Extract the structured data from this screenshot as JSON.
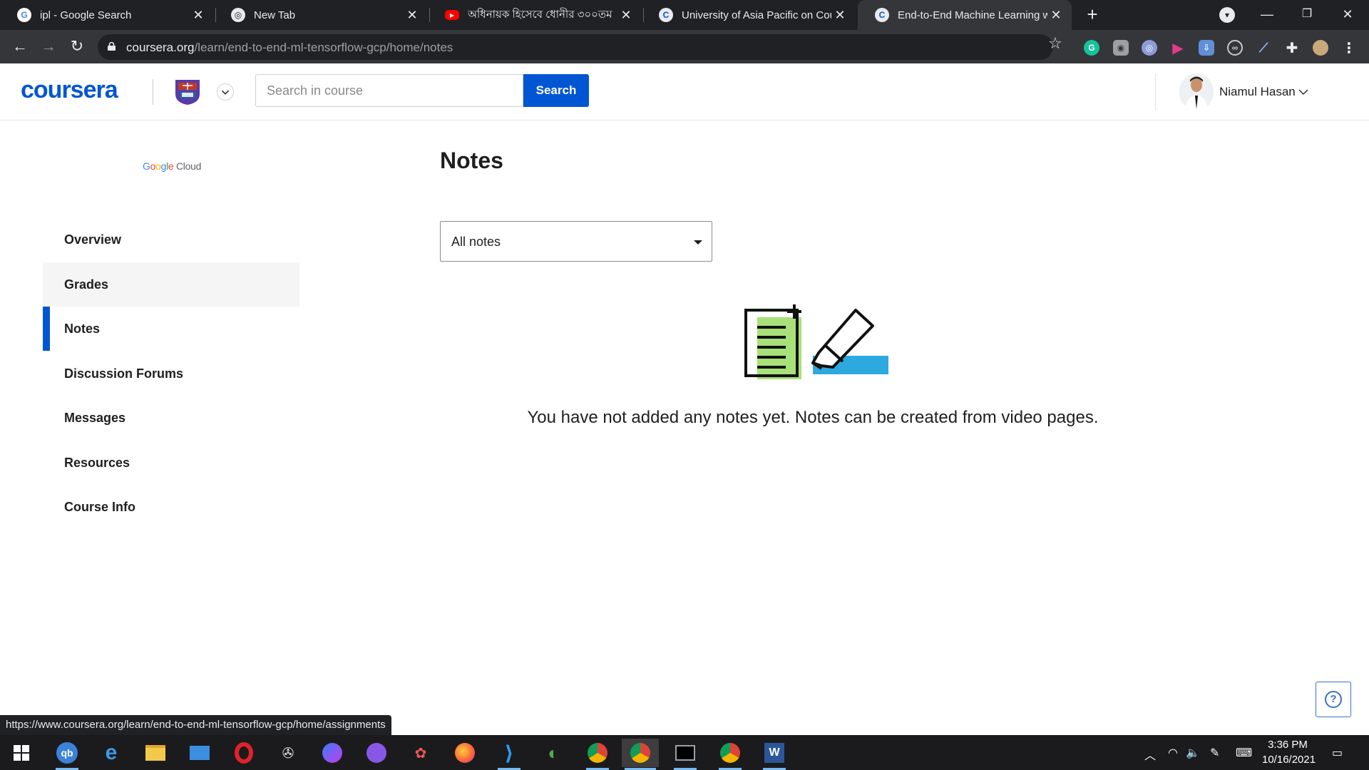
{
  "browser": {
    "tabs": [
      {
        "title": "ipl - Google Search",
        "favicon": "google-g-icon",
        "active": false
      },
      {
        "title": "New Tab",
        "favicon": "chrome-icon",
        "active": false
      },
      {
        "title": "অধিনায়ক হিসেবে ধোনীর ৩০০তম",
        "favicon": "youtube-icon",
        "active": false
      },
      {
        "title": "University of Asia Pacific on Cour",
        "favicon": "coursera-icon",
        "active": false
      },
      {
        "title": "End-to-End Machine Learning wi",
        "favicon": "coursera-icon",
        "active": true
      }
    ],
    "url_host": "coursera.org",
    "url_path": "/learn/end-to-end-ml-tensorflow-gcp/home/notes",
    "status_url": "https://www.coursera.org/learn/end-to-end-ml-tensorflow-gcp/home/assignments"
  },
  "header": {
    "logo": "coursera",
    "search_placeholder": "Search in course",
    "search_button": "Search",
    "user_name": "Niamul Hasan"
  },
  "sidebar": {
    "partner_logo": {
      "g": "G",
      "o1": "o",
      "o2": "o",
      "g2": "g",
      "l": "l",
      "e": "e",
      "cloud": " Cloud"
    },
    "items": [
      {
        "label": "Overview"
      },
      {
        "label": "Grades"
      },
      {
        "label": "Notes"
      },
      {
        "label": "Discussion Forums"
      },
      {
        "label": "Messages"
      },
      {
        "label": "Resources"
      },
      {
        "label": "Course Info"
      }
    ]
  },
  "main": {
    "title": "Notes",
    "filter_value": "All notes",
    "empty_message": "You have not added any notes yet. Notes can be created from video pages."
  },
  "taskbar": {
    "time": "3:36 PM",
    "date": "10/16/2021",
    "apps": [
      "search-icon",
      "edge-icon",
      "file-explorer-icon",
      "mail-icon",
      "opera-icon",
      "app-icon",
      "messenger-icon",
      "github-icon",
      "paint-icon",
      "firefox-icon",
      "vscode-icon",
      "app-icon",
      "chrome-icon",
      "chrome-icon",
      "terminal-icon",
      "chrome-icon",
      "word-icon"
    ]
  },
  "colors": {
    "brand": "#0056d2",
    "notes_green": "#a8e07a",
    "highlight_blue": "#2ea9df"
  }
}
